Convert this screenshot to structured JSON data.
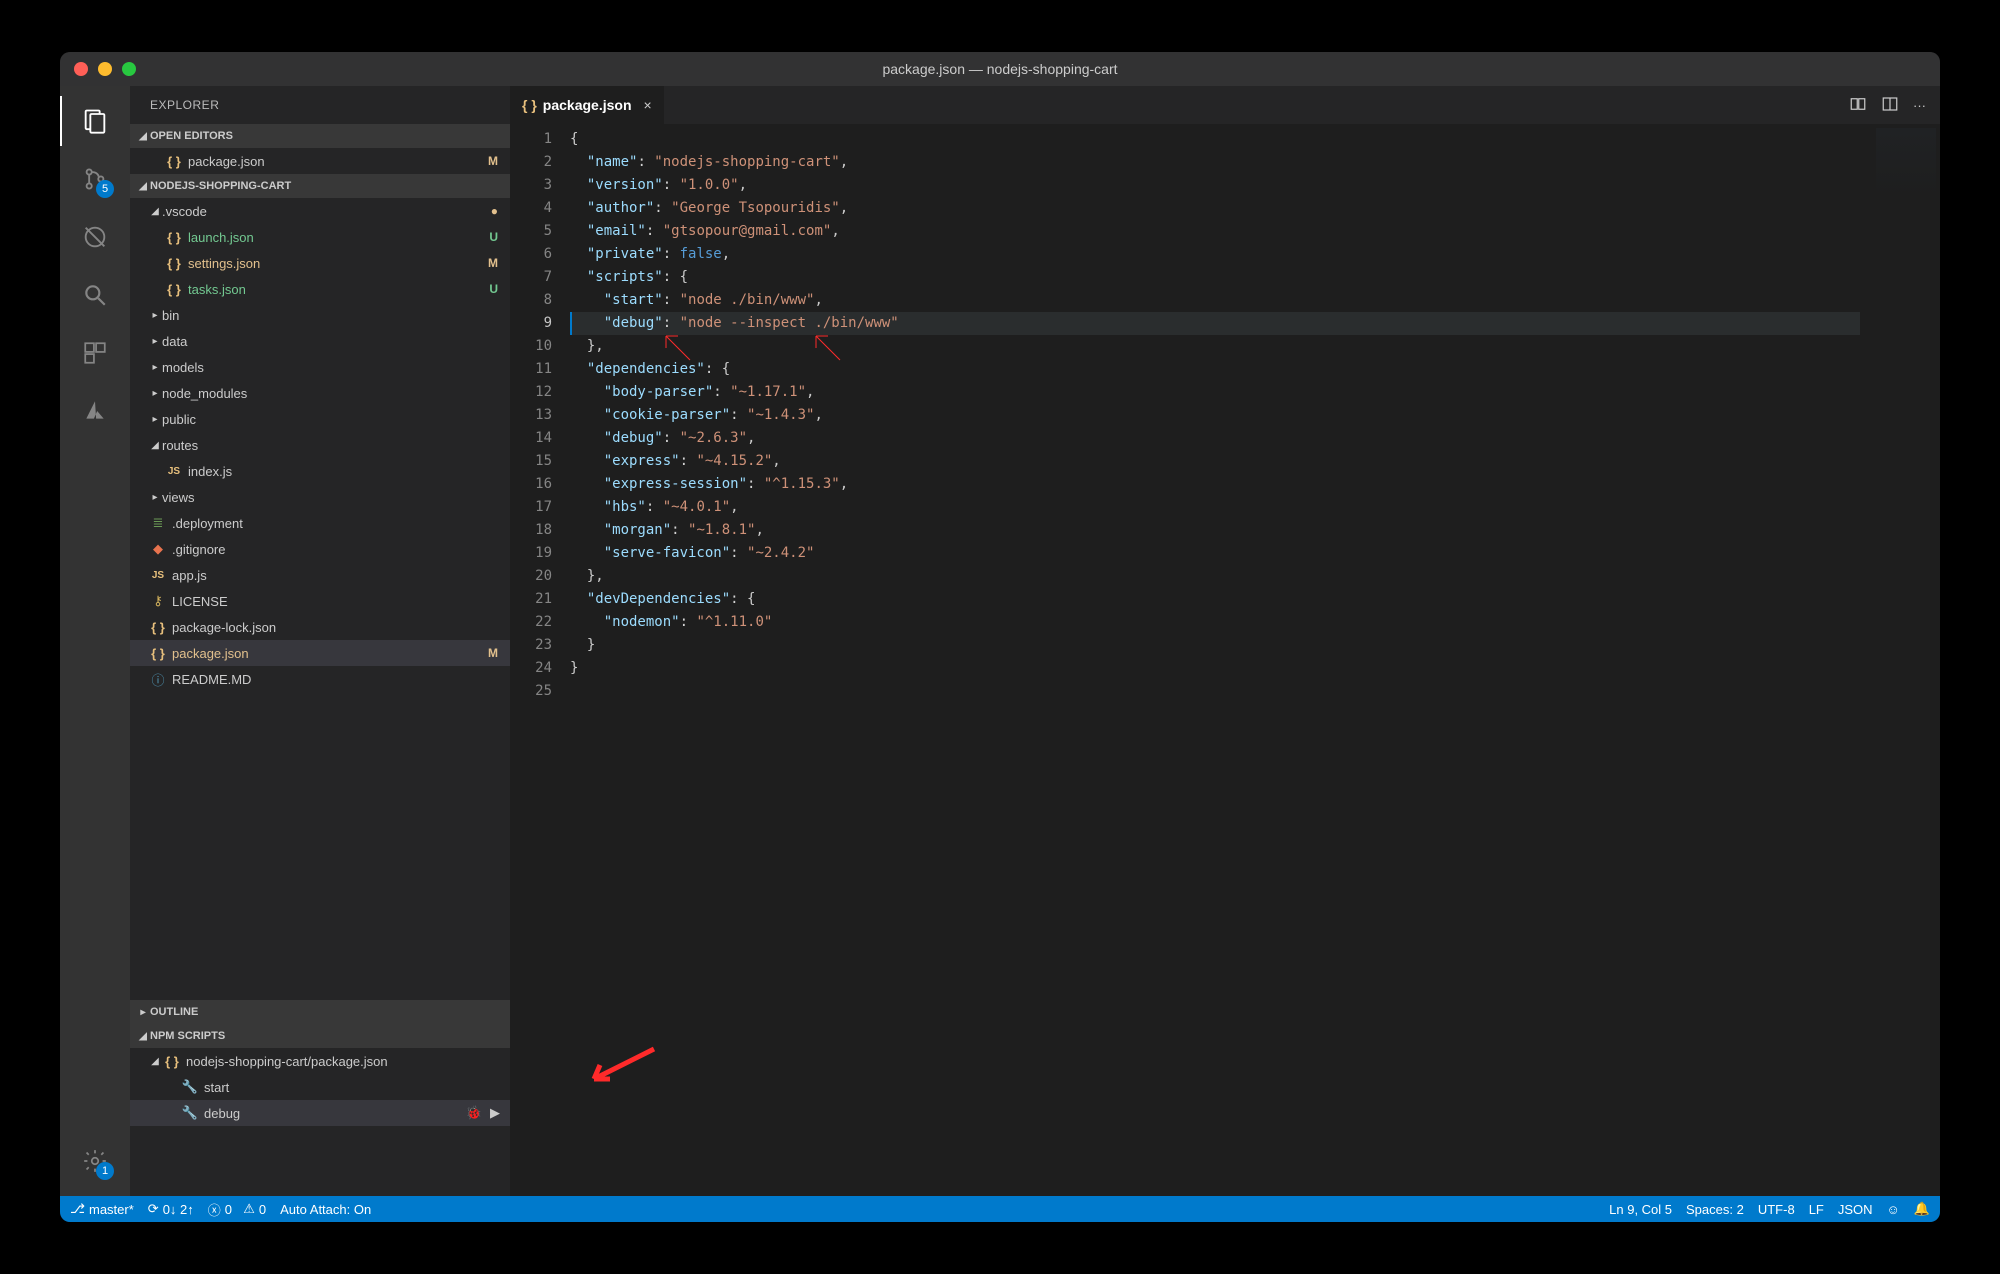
{
  "window": {
    "title": "package.json — nodejs-shopping-cart"
  },
  "activitybar": {
    "scm_badge": "5",
    "settings_badge": "1"
  },
  "sidebar": {
    "title": "EXPLORER",
    "sections": {
      "open_editors": "OPEN EDITORS",
      "workspace": "NODEJS-SHOPPING-CART",
      "outline": "OUTLINE",
      "npm": "NPM SCRIPTS"
    },
    "open_editors": [
      {
        "name": "package.json",
        "status": "M"
      }
    ],
    "tree": [
      {
        "type": "folder",
        "name": ".vscode",
        "expanded": true,
        "indent": 1,
        "dot": "#e2c08d"
      },
      {
        "type": "file",
        "name": "launch.json",
        "icon": "brk",
        "status": "U",
        "indent": 2,
        "gitclass": "gitu"
      },
      {
        "type": "file",
        "name": "settings.json",
        "icon": "brk",
        "status": "M",
        "indent": 2,
        "gitclass": "gitm"
      },
      {
        "type": "file",
        "name": "tasks.json",
        "icon": "brk",
        "status": "U",
        "indent": 2,
        "gitclass": "gitu"
      },
      {
        "type": "folder",
        "name": "bin",
        "expanded": false,
        "indent": 1
      },
      {
        "type": "folder",
        "name": "data",
        "expanded": false,
        "indent": 1
      },
      {
        "type": "folder",
        "name": "models",
        "expanded": false,
        "indent": 1
      },
      {
        "type": "folder",
        "name": "node_modules",
        "expanded": false,
        "indent": 1
      },
      {
        "type": "folder",
        "name": "public",
        "expanded": false,
        "indent": 1
      },
      {
        "type": "folder",
        "name": "routes",
        "expanded": true,
        "indent": 1
      },
      {
        "type": "file",
        "name": "index.js",
        "icon": "js",
        "indent": 2
      },
      {
        "type": "folder",
        "name": "views",
        "expanded": false,
        "indent": 1
      },
      {
        "type": "file",
        "name": ".deployment",
        "icon": "lines",
        "indent": 1
      },
      {
        "type": "file",
        "name": ".gitignore",
        "icon": "git",
        "indent": 1
      },
      {
        "type": "file",
        "name": "app.js",
        "icon": "js",
        "indent": 1
      },
      {
        "type": "file",
        "name": "LICENSE",
        "icon": "key",
        "indent": 1
      },
      {
        "type": "file",
        "name": "package-lock.json",
        "icon": "brk",
        "indent": 1
      },
      {
        "type": "file",
        "name": "package.json",
        "icon": "brk",
        "status": "M",
        "indent": 1,
        "gitclass": "gitm",
        "selected": true
      },
      {
        "type": "file",
        "name": "README.MD",
        "icon": "info",
        "indent": 1
      }
    ],
    "npm": {
      "package_label": "nodejs-shopping-cart/package.json",
      "scripts": [
        {
          "name": "start",
          "active": false
        },
        {
          "name": "debug",
          "active": true
        }
      ]
    }
  },
  "tabs": {
    "open": [
      {
        "label": "package.json",
        "icon": "brk",
        "active": true
      }
    ]
  },
  "editor": {
    "active_line": 9,
    "lines": [
      "{",
      "  \"name\": \"nodejs-shopping-cart\",",
      "  \"version\": \"1.0.0\",",
      "  \"author\": \"George Tsopouridis\",",
      "  \"email\": \"gtsopour@gmail.com\",",
      "  \"private\": false,",
      "  \"scripts\": {",
      "    \"start\": \"node ./bin/www\",",
      "    \"debug\": \"node --inspect ./bin/www\"",
      "  },",
      "  \"dependencies\": {",
      "    \"body-parser\": \"~1.17.1\",",
      "    \"cookie-parser\": \"~1.4.3\",",
      "    \"debug\": \"~2.6.3\",",
      "    \"express\": \"~4.15.2\",",
      "    \"express-session\": \"^1.15.3\",",
      "    \"hbs\": \"~4.0.1\",",
      "    \"morgan\": \"~1.8.1\",",
      "    \"serve-favicon\": \"~2.4.2\"",
      "  },",
      "  \"devDependencies\": {",
      "    \"nodemon\": \"^1.11.0\"",
      "  }",
      "}",
      ""
    ]
  },
  "statusbar": {
    "branch": "master*",
    "sync": "0↓ 2↑",
    "errors": "0",
    "warnings": "0",
    "auto_attach": "Auto Attach: On",
    "ln_col": "Ln 9, Col 5",
    "spaces": "Spaces: 2",
    "encoding": "UTF-8",
    "eol": "LF",
    "lang": "JSON"
  }
}
